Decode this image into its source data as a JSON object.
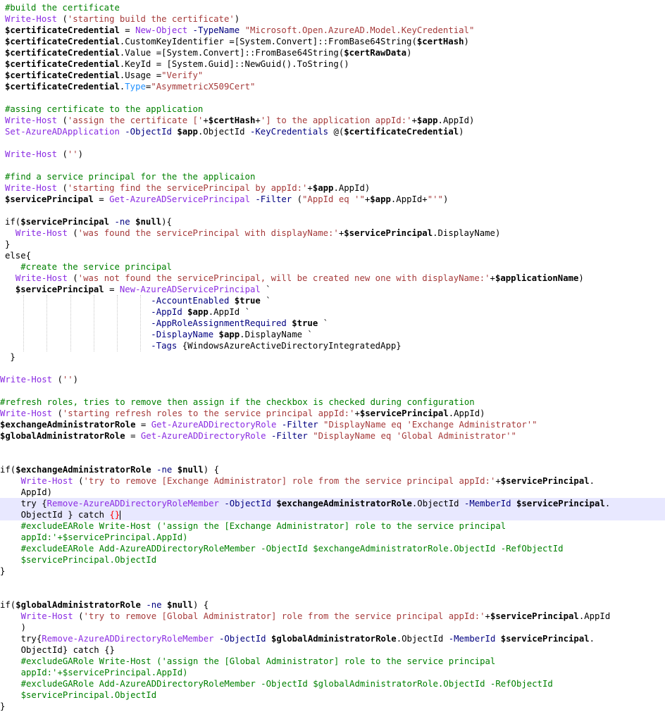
{
  "colors": {
    "background": "#ffffff",
    "current_line": "#e8e8ff",
    "comment": "#008000",
    "cmdlet": "#8a2be2",
    "string": "#8b0000",
    "parameter": "#000080",
    "variable": "#000000",
    "highlight_property": "#1e90ff",
    "brace_match": "#ff0000"
  },
  "editor": {
    "lines": [
      [
        [
          "c",
          "#build the certificate"
        ]
      ],
      [
        [
          "k",
          "Write-Host"
        ],
        [
          "p",
          " ("
        ],
        [
          "s",
          "'starting build the certificate'"
        ],
        [
          "p",
          ")"
        ]
      ],
      [
        [
          "v",
          "$certificateCredential"
        ],
        [
          "p",
          " = "
        ],
        [
          "k",
          "New-Object"
        ],
        [
          "p",
          " "
        ],
        [
          "a",
          "-TypeName"
        ],
        [
          "p",
          " "
        ],
        [
          "s",
          "\"Microsoft.Open.AzureAD.Model.KeyCredential\""
        ]
      ],
      [
        [
          "v",
          "$certificateCredential"
        ],
        [
          "p",
          ".CustomKeyIdentifier =[System.Convert]::FromBase64String("
        ],
        [
          "v",
          "$certHash"
        ],
        [
          "p",
          ")"
        ]
      ],
      [
        [
          "v",
          "$certificateCredential"
        ],
        [
          "p",
          ".Value =[System.Convert]::FromBase64String("
        ],
        [
          "v",
          "$certRawData"
        ],
        [
          "p",
          ")"
        ]
      ],
      [
        [
          "v",
          "$certificateCredential"
        ],
        [
          "p",
          ".KeyId = [System.Guid]::NewGuid().ToString()"
        ]
      ],
      [
        [
          "v",
          "$certificateCredential"
        ],
        [
          "p",
          ".Usage ="
        ],
        [
          "s",
          "\"Verify\""
        ]
      ],
      [
        [
          "v",
          "$certificateCredential"
        ],
        [
          "p",
          "."
        ],
        [
          "h",
          "Type"
        ],
        [
          "p",
          "="
        ],
        [
          "s",
          "\"AsymmetricX509Cert\""
        ]
      ],
      [],
      [
        [
          "c",
          "#assing certificate to the application"
        ]
      ],
      [
        [
          "k",
          "Write-Host"
        ],
        [
          "p",
          " ("
        ],
        [
          "s",
          "'assign the certificate ['"
        ],
        [
          "p",
          "+"
        ],
        [
          "v",
          "$certHash"
        ],
        [
          "p",
          "+"
        ],
        [
          "s",
          "'] to the application appId:'"
        ],
        [
          "p",
          "+"
        ],
        [
          "v",
          "$app"
        ],
        [
          "p",
          ".AppId)"
        ]
      ],
      [
        [
          "k",
          "Set-AzureADApplication"
        ],
        [
          "p",
          " "
        ],
        [
          "a",
          "-ObjectId"
        ],
        [
          "p",
          " "
        ],
        [
          "v",
          "$app"
        ],
        [
          "p",
          ".ObjectId "
        ],
        [
          "a",
          "-KeyCredentials"
        ],
        [
          "p",
          " @("
        ],
        [
          "v",
          "$certificateCredential"
        ],
        [
          "p",
          ")"
        ]
      ],
      [],
      [
        [
          "k",
          "Write-Host"
        ],
        [
          "p",
          " ("
        ],
        [
          "s",
          "''"
        ],
        [
          "p",
          ")"
        ]
      ],
      [],
      [
        [
          "c",
          "#find a service principal for the the applicaion"
        ]
      ],
      [
        [
          "k",
          "Write-Host"
        ],
        [
          "p",
          " ("
        ],
        [
          "s",
          "'starting find the servicePrincipal by appId:'"
        ],
        [
          "p",
          "+"
        ],
        [
          "v",
          "$app"
        ],
        [
          "p",
          ".AppId)"
        ]
      ],
      [
        [
          "v",
          "$servicePrincipal"
        ],
        [
          "p",
          " = "
        ],
        [
          "k",
          "Get-AzureADServicePrincipal"
        ],
        [
          "p",
          " "
        ],
        [
          "a",
          "-Filter"
        ],
        [
          "p",
          " ("
        ],
        [
          "s",
          "\"AppId eq '\""
        ],
        [
          "p",
          "+"
        ],
        [
          "v",
          "$app"
        ],
        [
          "p",
          ".AppId+"
        ],
        [
          "s",
          "\"'\""
        ],
        [
          "p",
          ")"
        ]
      ],
      [],
      [
        [
          "p",
          "if("
        ],
        [
          "v",
          "$servicePrincipal"
        ],
        [
          "p",
          " "
        ],
        [
          "a",
          "-ne"
        ],
        [
          "p",
          " "
        ],
        [
          "v",
          "$null"
        ],
        [
          "p",
          "){"
        ]
      ],
      [
        [
          "p",
          "  "
        ],
        [
          "k",
          "Write-Host"
        ],
        [
          "p",
          " ("
        ],
        [
          "s",
          "'was found the servicePrincipal with displayName:'"
        ],
        [
          "p",
          "+"
        ],
        [
          "v",
          "$servicePrincipal"
        ],
        [
          "p",
          ".DisplayName)"
        ]
      ],
      [
        [
          "p",
          "}"
        ]
      ],
      [
        [
          "p",
          "else{"
        ]
      ],
      [
        [
          "p",
          "   "
        ],
        [
          "c",
          "#create the service principal"
        ]
      ],
      [
        [
          "p",
          "  "
        ],
        [
          "k",
          "Write-Host"
        ],
        [
          "p",
          " ("
        ],
        [
          "s",
          "'was not found the servicePrincipal, will be created new one with displayName:'"
        ],
        [
          "p",
          "+"
        ],
        [
          "v",
          "$applicationName"
        ],
        [
          "p",
          ")"
        ]
      ],
      [
        [
          "p",
          "  "
        ],
        [
          "v",
          "$servicePrincipal"
        ],
        [
          "p",
          " = "
        ],
        [
          "k",
          "New-AzureADServicePrincipal"
        ],
        [
          "p",
          " `"
        ]
      ],
      [
        [
          "p",
          "                            "
        ],
        [
          "a",
          "-AccountEnabled"
        ],
        [
          "p",
          " "
        ],
        [
          "v",
          "$true"
        ],
        [
          "p",
          " `"
        ]
      ],
      [
        [
          "p",
          "                            "
        ],
        [
          "a",
          "-AppId"
        ],
        [
          "p",
          " "
        ],
        [
          "v",
          "$app"
        ],
        [
          "p",
          ".AppId `"
        ]
      ],
      [
        [
          "p",
          "                            "
        ],
        [
          "a",
          "-AppRoleAssignmentRequired"
        ],
        [
          "p",
          " "
        ],
        [
          "v",
          "$true"
        ],
        [
          "p",
          " `"
        ]
      ],
      [
        [
          "p",
          "                            "
        ],
        [
          "a",
          "-DisplayName"
        ],
        [
          "p",
          " "
        ],
        [
          "v",
          "$app"
        ],
        [
          "p",
          ".DisplayName `"
        ]
      ],
      [
        [
          "p",
          "                            "
        ],
        [
          "a",
          "-Tags"
        ],
        [
          "p",
          " {WindowsAzureActiveDirectoryIntegratedApp}"
        ]
      ],
      [
        [
          "p",
          " }"
        ]
      ],
      [],
      [
        [
          "k",
          "Write-Host"
        ],
        [
          "p",
          " ("
        ],
        [
          "s",
          "''"
        ],
        [
          "p",
          ")"
        ]
      ],
      [],
      [
        [
          "c",
          "#refresh roles, tries to remove then assign if the checkbox is checked during configuration"
        ]
      ],
      [
        [
          "k",
          "Write-Host"
        ],
        [
          "p",
          " ("
        ],
        [
          "s",
          "'starting refresh roles to the service principal appId:'"
        ],
        [
          "p",
          "+"
        ],
        [
          "v",
          "$servicePrincipal"
        ],
        [
          "p",
          ".AppId)"
        ]
      ],
      [
        [
          "v",
          "$exchangeAdministratorRole"
        ],
        [
          "p",
          " = "
        ],
        [
          "k",
          "Get-AzureADDirectoryRole"
        ],
        [
          "p",
          " "
        ],
        [
          "a",
          "-Filter"
        ],
        [
          "p",
          " "
        ],
        [
          "s",
          "\"DisplayName eq 'Exchange Administrator'\""
        ]
      ],
      [
        [
          "v",
          "$globalAdministratorRole"
        ],
        [
          "p",
          " = "
        ],
        [
          "k",
          "Get-AzureADDirectoryRole"
        ],
        [
          "p",
          " "
        ],
        [
          "a",
          "-Filter"
        ],
        [
          "p",
          " "
        ],
        [
          "s",
          "\"DisplayName eq 'Global Administrator'\""
        ]
      ],
      [],
      [],
      [
        [
          "p",
          "if("
        ],
        [
          "v",
          "$exchangeAdministratorRole"
        ],
        [
          "p",
          " "
        ],
        [
          "a",
          "-ne"
        ],
        [
          "p",
          " "
        ],
        [
          "v",
          "$null"
        ],
        [
          "p",
          ") {"
        ]
      ],
      [
        [
          "p",
          "    "
        ],
        [
          "k",
          "Write-Host"
        ],
        [
          "p",
          " ("
        ],
        [
          "s",
          "'try to remove [Exchange Administrator] role from the service principal appId:'"
        ],
        [
          "p",
          "+"
        ],
        [
          "v",
          "$servicePrincipal"
        ],
        [
          "p",
          "."
        ]
      ],
      [
        [
          "p",
          "    AppId)"
        ]
      ],
      [
        [
          "p",
          "    try {"
        ],
        [
          "k",
          "Remove-AzureADDirectoryRoleMember"
        ],
        [
          "p",
          " "
        ],
        [
          "a",
          "-ObjectId"
        ],
        [
          "p",
          " "
        ],
        [
          "v",
          "$exchangeAdministratorRole"
        ],
        [
          "p",
          ".ObjectId "
        ],
        [
          "a",
          "-MemberId"
        ],
        [
          "p",
          " "
        ],
        [
          "v",
          "$servicePrincipal"
        ],
        [
          "p",
          "."
        ]
      ],
      [
        [
          "p",
          "    ObjectId } catch "
        ],
        [
          "r",
          "{}"
        ]
      ],
      [
        [
          "p",
          "    "
        ],
        [
          "c",
          "#excludeEARole Write-Host ('assign the [Exchange Administrator] role to the service principal"
        ]
      ],
      [
        [
          "p",
          "    "
        ],
        [
          "c",
          "appId:'+$servicePrincipal.AppId)"
        ]
      ],
      [
        [
          "p",
          "    "
        ],
        [
          "c",
          "#excludeEARole Add-AzureADDirectoryRoleMember -ObjectId $exchangeAdministratorRole.ObjectId -RefObjectId"
        ]
      ],
      [
        [
          "p",
          "    "
        ],
        [
          "c",
          "$servicePrincipal.ObjectId"
        ]
      ],
      [
        [
          "p",
          "}"
        ]
      ],
      [],
      [],
      [
        [
          "p",
          "if("
        ],
        [
          "v",
          "$globalAdministratorRole"
        ],
        [
          "p",
          " "
        ],
        [
          "a",
          "-ne"
        ],
        [
          "p",
          " "
        ],
        [
          "v",
          "$null"
        ],
        [
          "p",
          ") {"
        ]
      ],
      [
        [
          "p",
          "    "
        ],
        [
          "k",
          "Write-Host"
        ],
        [
          "p",
          " ("
        ],
        [
          "s",
          "'try to remove [Global Administrator] role from the service principal appId:'"
        ],
        [
          "p",
          "+"
        ],
        [
          "v",
          "$servicePrincipal"
        ],
        [
          "p",
          ".AppId"
        ]
      ],
      [
        [
          "p",
          "    )"
        ]
      ],
      [
        [
          "p",
          "    try{"
        ],
        [
          "k",
          "Remove-AzureADDirectoryRoleMember"
        ],
        [
          "p",
          " "
        ],
        [
          "a",
          "-ObjectId"
        ],
        [
          "p",
          " "
        ],
        [
          "v",
          "$globalAdministratorRole"
        ],
        [
          "p",
          ".ObjectId "
        ],
        [
          "a",
          "-MemberId"
        ],
        [
          "p",
          " "
        ],
        [
          "v",
          "$servicePrincipal"
        ],
        [
          "p",
          "."
        ]
      ],
      [
        [
          "p",
          "    ObjectId} catch {}"
        ]
      ],
      [
        [
          "p",
          "    "
        ],
        [
          "c",
          "#excludeGARole Write-Host ('assign the [Global Administrator] role to the service principal"
        ]
      ],
      [
        [
          "p",
          "    "
        ],
        [
          "c",
          "appId:'+$servicePrincipal.AppId)"
        ]
      ],
      [
        [
          "p",
          "    "
        ],
        [
          "c",
          "#excludeGARole Add-AzureADDirectoryRoleMember -ObjectId $globalAdministratorRole.ObjectId -RefObjectId"
        ]
      ],
      [
        [
          "p",
          "    "
        ],
        [
          "c",
          "$servicePrincipal.ObjectId"
        ]
      ],
      [
        [
          "p",
          "}"
        ]
      ]
    ]
  }
}
